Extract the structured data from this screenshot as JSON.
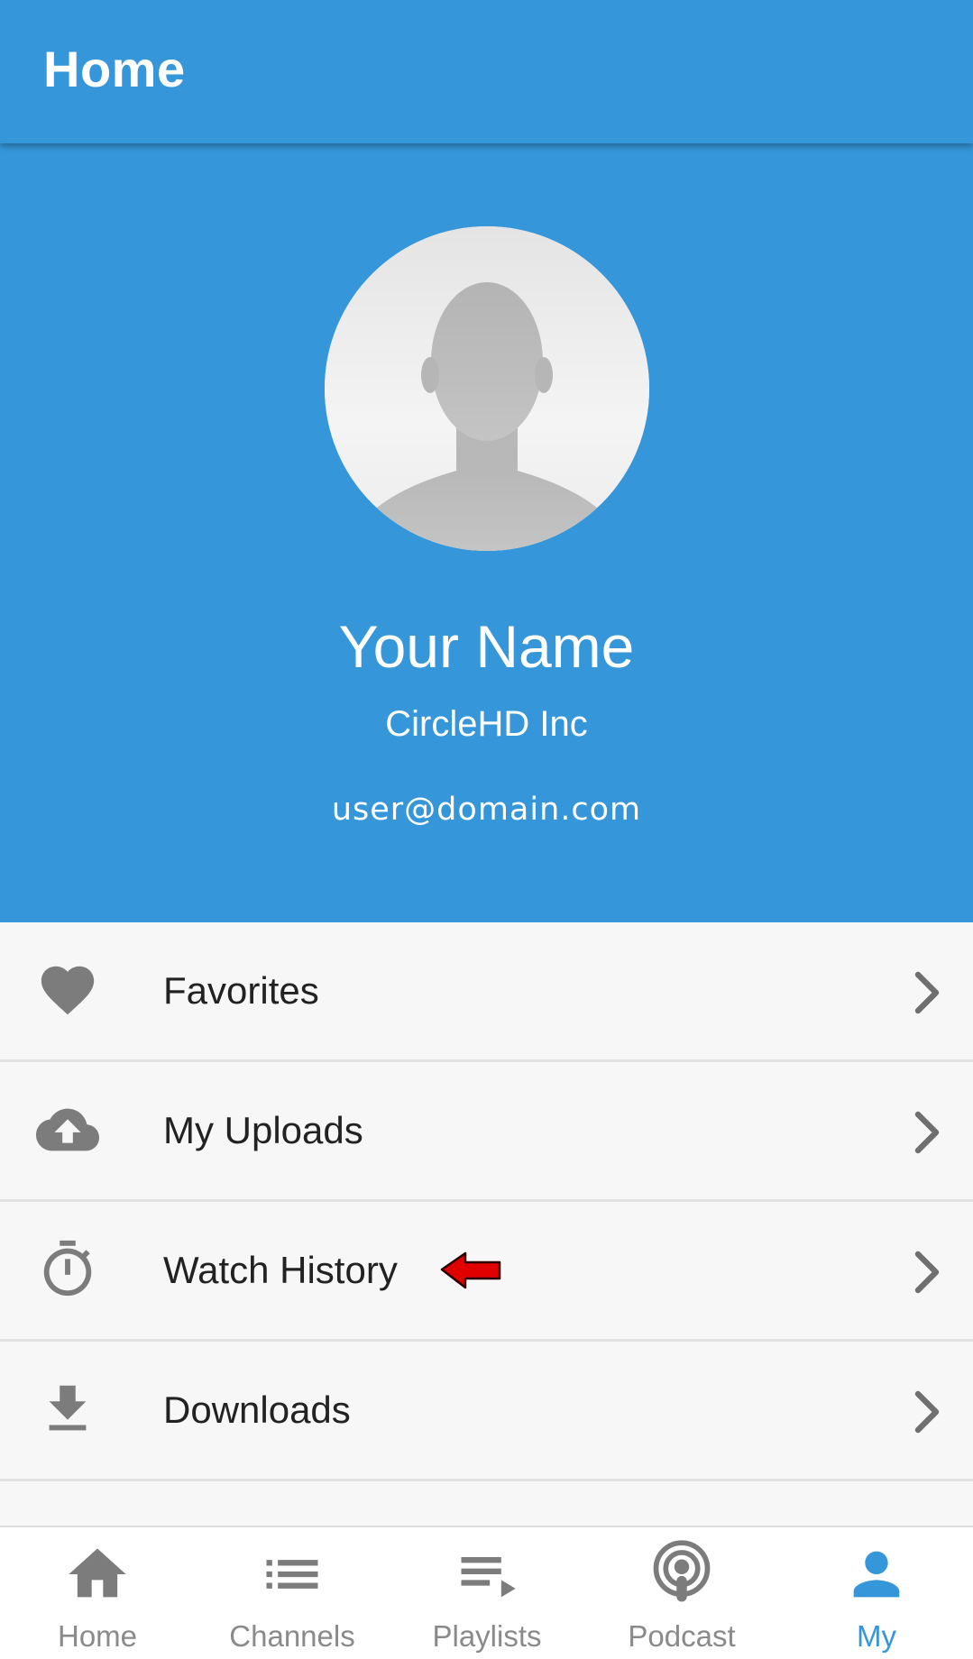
{
  "app_bar": {
    "title": "Home"
  },
  "profile": {
    "name": "Your Name",
    "company": "CircleHD Inc",
    "email": "user@domain.com",
    "avatar_icon": "default-avatar-silhouette"
  },
  "menu": {
    "items": [
      {
        "label": "Favorites",
        "icon": "heart-icon"
      },
      {
        "label": "My Uploads",
        "icon": "cloud-upload-icon"
      },
      {
        "label": "Watch History",
        "icon": "stopwatch-icon"
      },
      {
        "label": "Downloads",
        "icon": "download-icon"
      }
    ]
  },
  "bottom_nav": {
    "items": [
      {
        "label": "Home",
        "icon": "home-icon",
        "active": false
      },
      {
        "label": "Channels",
        "icon": "list-icon",
        "active": false
      },
      {
        "label": "Playlists",
        "icon": "playlist-icon",
        "active": false
      },
      {
        "label": "Podcast",
        "icon": "podcast-icon",
        "active": false
      },
      {
        "label": "My",
        "icon": "person-icon",
        "active": true
      }
    ]
  },
  "colors": {
    "primary": "#3597d9",
    "icon_gray": "#7c7c7c",
    "annotation_arrow": "#e00000",
    "background": "#f7f7f7"
  }
}
